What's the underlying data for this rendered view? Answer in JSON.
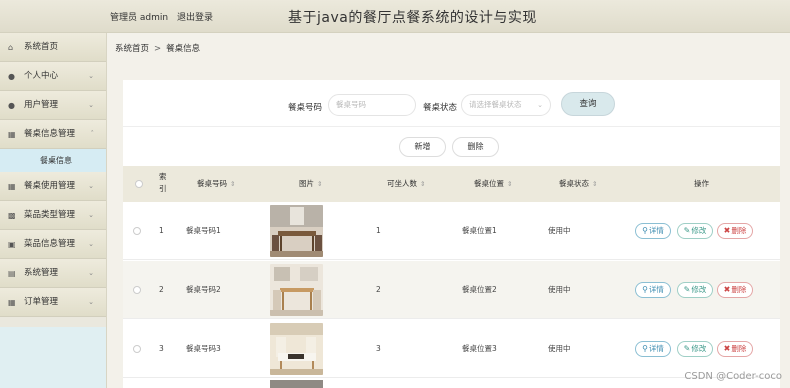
{
  "header": {
    "admin_label": "管理员 admin",
    "logout": "退出登录",
    "title": "基于java的餐厅点餐系统的设计与实现"
  },
  "sidebar": {
    "items": [
      {
        "label": "系统首页",
        "icon": "home-icon"
      },
      {
        "label": "个人中心",
        "icon": "user-icon"
      },
      {
        "label": "用户管理",
        "icon": "user-icon"
      },
      {
        "label": "餐桌信息管理",
        "icon": "grid-icon"
      },
      {
        "label": "餐桌信息",
        "icon": ""
      },
      {
        "label": "餐桌使用管理",
        "icon": "grid-icon"
      },
      {
        "label": "菜品类型管理",
        "icon": "bar-chart-icon"
      },
      {
        "label": "菜品信息管理",
        "icon": "clipboard-icon"
      },
      {
        "label": "系统管理",
        "icon": "list-icon"
      },
      {
        "label": "订单管理",
        "icon": "grid-icon"
      }
    ]
  },
  "breadcrumb": {
    "home": "系统首页",
    "separator": ">",
    "current": "餐桌信息"
  },
  "search": {
    "table_no_label": "餐桌号码",
    "table_no_placeholder": "餐桌号码",
    "status_label": "餐桌状态",
    "status_placeholder": "请选择餐桌状态",
    "query_button": "查询"
  },
  "actions": {
    "add": "新增",
    "delete": "删除"
  },
  "table": {
    "headers": {
      "index": "索引",
      "table_no": "餐桌号码",
      "image": "图片",
      "seats": "可坐人数",
      "location": "餐桌位置",
      "status": "餐桌状态",
      "operations": "操作"
    },
    "rows": [
      {
        "index": "1",
        "table_no": "餐桌号码1",
        "seats": "1",
        "location": "餐桌位置1",
        "status": "使用中"
      },
      {
        "index": "2",
        "table_no": "餐桌号码2",
        "seats": "2",
        "location": "餐桌位置2",
        "status": "使用中"
      },
      {
        "index": "3",
        "table_no": "餐桌号码3",
        "seats": "3",
        "location": "餐桌位置3",
        "status": "使用中"
      }
    ],
    "row_actions": {
      "view": "详情",
      "edit": "修改",
      "delete": "删除"
    }
  },
  "watermark": "CSDN @Coder-coco",
  "colors": {
    "header_bg": "#e6e3d3",
    "sidebar_bg": "#eae8de",
    "submenu_bg": "#d6ecf3",
    "query_btn": "#d9e9ec",
    "delete_red": "#c44"
  }
}
